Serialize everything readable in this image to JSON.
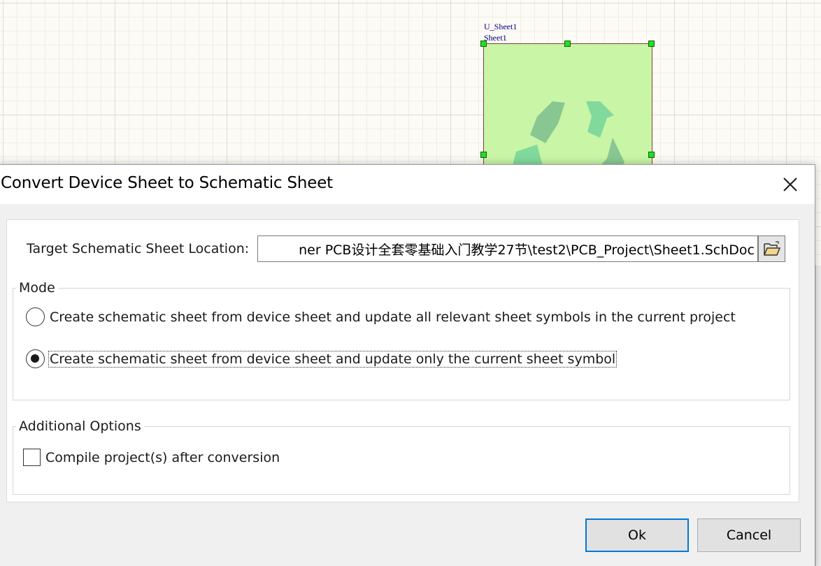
{
  "schematic": {
    "sheet_symbol": {
      "designator": "U_Sheet1",
      "file_name": "Sheet1",
      "fill_color": "#c8f5a6",
      "icon": "recycle-icon"
    }
  },
  "dialog": {
    "title": "Convert Device Sheet to Schematic Sheet",
    "close_icon": "close-icon",
    "target_location": {
      "label": "Target Schematic Sheet Location:",
      "value": "ner PCB设计全套零基础入门教学27节\\test2\\PCB_Project\\Sheet1.SchDoc",
      "browse_icon": "folder-open-icon"
    },
    "mode": {
      "legend": "Mode",
      "options": [
        {
          "label": "Create schematic sheet from device sheet and update all relevant sheet symbols in the current project",
          "checked": false
        },
        {
          "label": "Create schematic sheet from device sheet and update only the current sheet symbol",
          "checked": true
        }
      ]
    },
    "additional_options": {
      "legend": "Additional Options",
      "compile_label": "Compile project(s) after conversion",
      "compile_checked": false
    },
    "buttons": {
      "ok": "Ok",
      "cancel": "Cancel"
    },
    "accent_color": "#0078d7"
  }
}
